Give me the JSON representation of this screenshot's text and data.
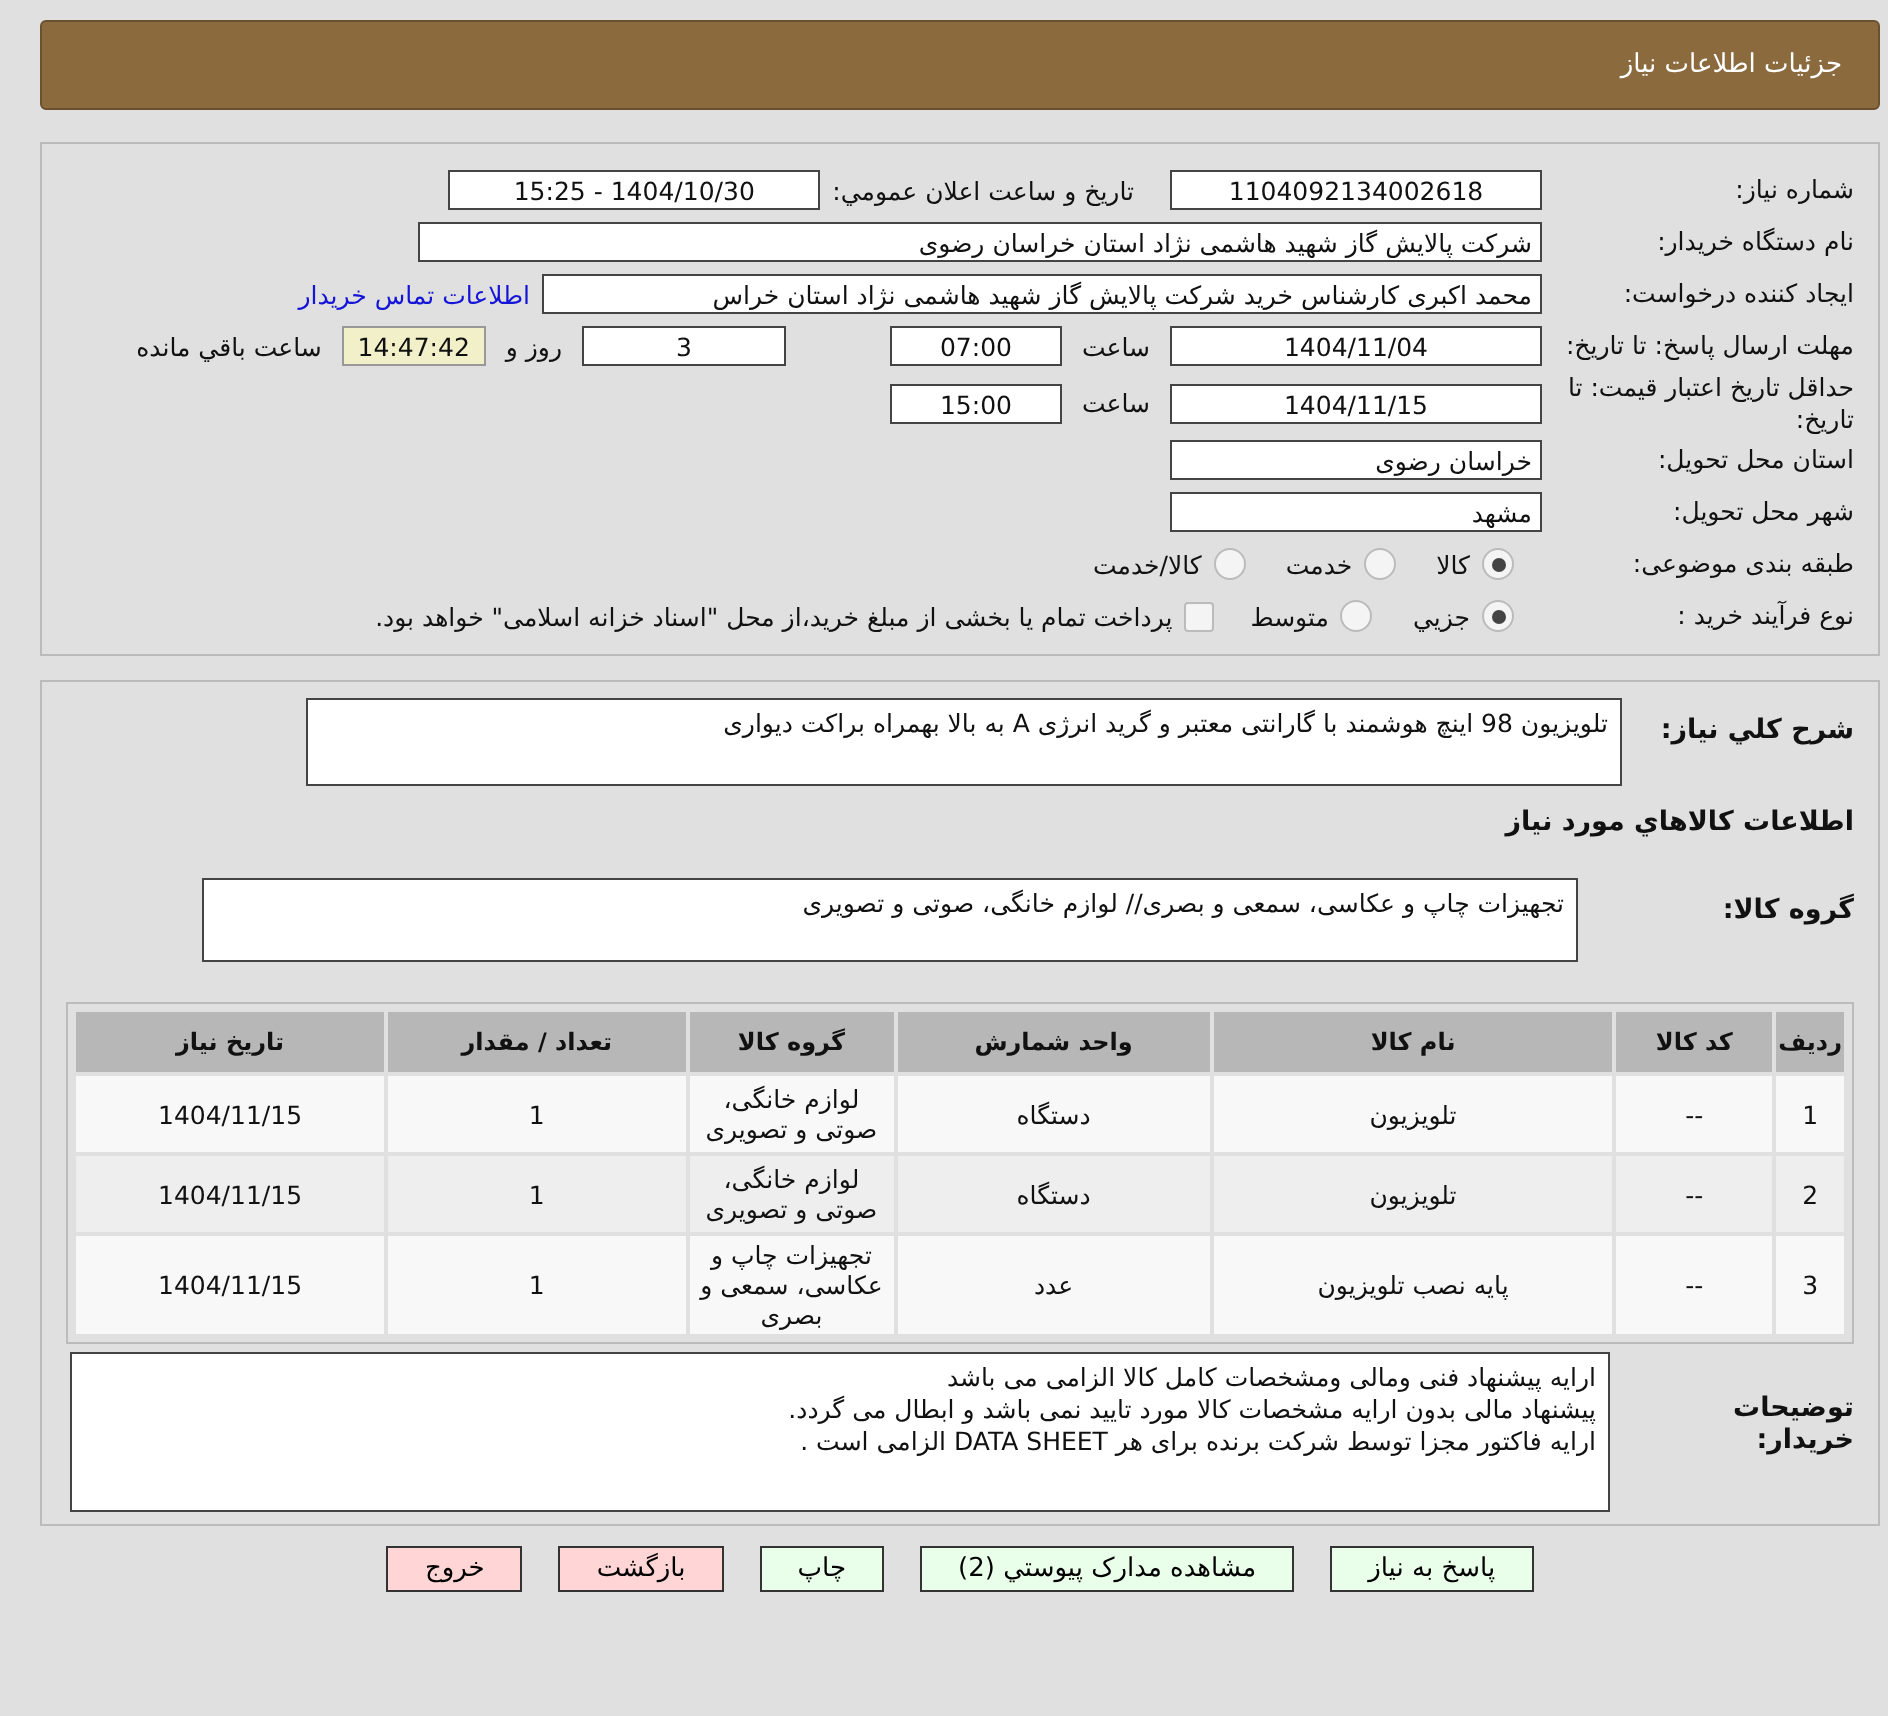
{
  "header": {
    "title": "جزئیات اطلاعات نیاز"
  },
  "info": {
    "need_number": {
      "label": "شماره نیاز:",
      "value": "1104092134002618"
    },
    "announce": {
      "label": "تاریخ و ساعت اعلان عمومي:",
      "value": "1404/10/30 - 15:25"
    },
    "buyer": {
      "label": "نام دستگاه خریدار:",
      "value": "شرکت پالایش گاز شهید هاشمی نژاد   استان خراسان رضوی"
    },
    "creator": {
      "label": "ایجاد کننده درخواست:",
      "value": "محمد اکبری کارشناس خرید شرکت پالایش گاز شهید هاشمی نژاد   استان خراس",
      "link": "اطلاعات تماس خریدار"
    },
    "deadline": {
      "label": "مهلت ارسال پاسخ: تا تاریخ:",
      "date": "1404/11/04",
      "time_label": "ساعت",
      "time": "07:00",
      "days": "3",
      "days_label": "روز و",
      "remaining": "14:47:42",
      "remaining_label": "ساعت باقي مانده"
    },
    "validity": {
      "label": "حداقل تاریخ اعتبار قیمت: تا تاریخ:",
      "date": "1404/11/15",
      "time_label": "ساعت",
      "time": "15:00"
    },
    "province": {
      "label": "استان محل تحویل:",
      "value": "خراسان رضوی"
    },
    "city": {
      "label": "شهر محل تحویل:",
      "value": "مشهد"
    },
    "category": {
      "label": "طبقه بندی موضوعی:",
      "options": [
        {
          "label": "کالا",
          "selected": true
        },
        {
          "label": "خدمت",
          "selected": false
        },
        {
          "label": "کالا/خدمت",
          "selected": false
        }
      ]
    },
    "process": {
      "label": "نوع فرآیند خرید :",
      "options": [
        {
          "label": "جزيي",
          "selected": true
        },
        {
          "label": "متوسط",
          "selected": false
        }
      ],
      "treasury": {
        "label": "پرداخت تمام یا بخشی از مبلغ خرید،از محل \"اسناد خزانه اسلامی\" خواهد بود.",
        "checked": false
      }
    }
  },
  "details": {
    "description": {
      "label": "شرح کلي نیاز:",
      "value": "تلویزیون 98 اینچ هوشمند با گارانتی معتبر و گرید انرژی A به بالا بهمراه براکت دیواری"
    },
    "goods_heading": "اطلاعات کالاهاي مورد نیاز",
    "group": {
      "label": "گروه کالا:",
      "value": "تجهیزات چاپ و عکاسی، سمعی و بصری// لوازم خانگی، صوتی و تصویری"
    },
    "table": {
      "columns": [
        "ردیف",
        "کد کالا",
        "نام کالا",
        "واحد شمارش",
        "گروه کالا",
        "تعداد / مقدار",
        "تاریخ نیاز"
      ],
      "rows": [
        [
          "1",
          "--",
          "تلویزیون",
          "دستگاه",
          "لوازم خانگی، صوتی و تصویری",
          "1",
          "1404/11/15"
        ],
        [
          "2",
          "--",
          "تلویزیون",
          "دستگاه",
          "لوازم خانگی، صوتی و تصویری",
          "1",
          "1404/11/15"
        ],
        [
          "3",
          "--",
          "پایه نصب تلویزیون",
          "عدد",
          "تجهیزات چاپ و عکاسی، سمعی و بصری",
          "1",
          "1404/11/15"
        ]
      ]
    },
    "notes": {
      "label": "توضیحات خریدار:",
      "lines": [
        "ارایه پیشنهاد فنی ومالی ومشخصات کامل کالا الزامی می باشد",
        "پیشنهاد مالی بدون ارایه مشخصات کالا مورد تایید نمی باشد و ابطال می گردد.",
        "ارایه فاکتور مجزا توسط شرکت برنده برای هر DATA SHEET الزامی است ."
      ]
    }
  },
  "buttons": [
    {
      "label": "پاسخ به نیاز",
      "kind": "action"
    },
    {
      "label": "مشاهده مدارک پیوستي (2)",
      "kind": "action"
    },
    {
      "label": "چاپ",
      "kind": "action"
    },
    {
      "label": "بازگشت",
      "kind": "exit"
    },
    {
      "label": "خروج",
      "kind": "exit"
    }
  ]
}
